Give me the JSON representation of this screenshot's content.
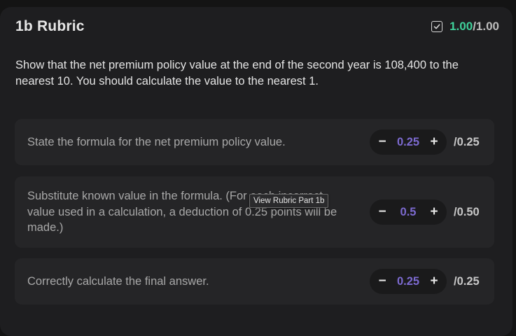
{
  "header": {
    "title": "1b Rubric",
    "score_earned": "1.00",
    "score_total": "/1.00",
    "status_icon": "checkbox-checked-icon"
  },
  "question": "Show that the net premium policy value at the end of the second year is 108,400 to the nearest 10. You should calculate the value to the nearest 1.",
  "criteria": [
    {
      "text": "State the formula for the net premium policy value.",
      "value": "0.25",
      "max": "/0.25",
      "minus_label": "−",
      "plus_label": "+"
    },
    {
      "text": "Substitute known value in the formula. (For each incorrect value used in a calculation, a deduction of 0.25 points will be made.)",
      "value": "0.5",
      "max": "/0.50",
      "minus_label": "−",
      "plus_label": "+"
    },
    {
      "text": "Correctly calculate the final answer.",
      "value": "0.25",
      "max": "/0.25",
      "minus_label": "−",
      "plus_label": "+"
    }
  ],
  "tooltip": "View Rubric Part 1b",
  "colors": {
    "accent_green": "#3fd19b",
    "accent_purple": "#7c6ad0",
    "panel_bg": "#1e1e20",
    "card_bg": "#252527"
  }
}
